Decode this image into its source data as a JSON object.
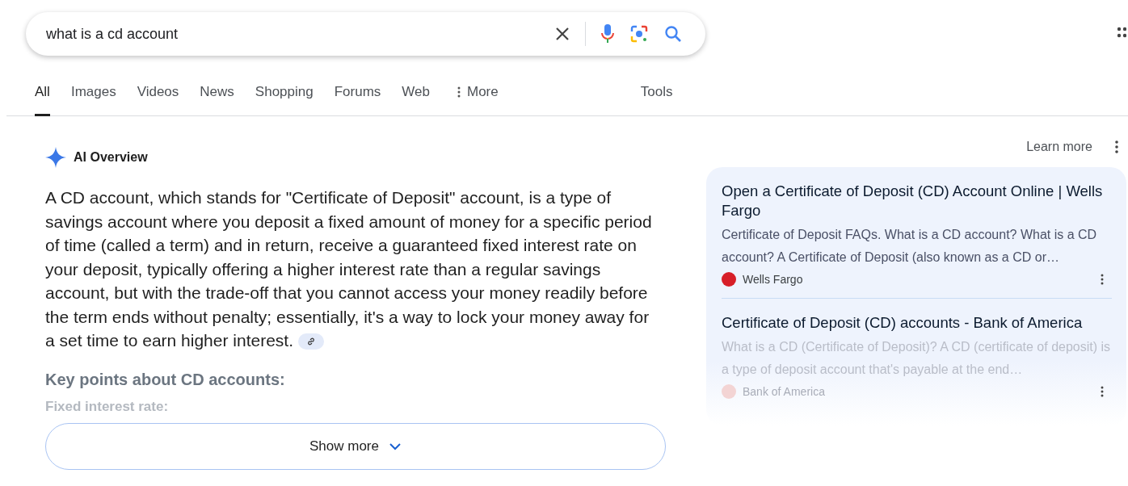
{
  "search": {
    "value": "what is a cd account"
  },
  "tabs": [
    {
      "label": "All",
      "selected": true
    },
    {
      "label": "Images",
      "selected": false
    },
    {
      "label": "Videos",
      "selected": false
    },
    {
      "label": "News",
      "selected": false
    },
    {
      "label": "Shopping",
      "selected": false
    },
    {
      "label": "Forums",
      "selected": false
    },
    {
      "label": "Web",
      "selected": false
    }
  ],
  "more_label": "More",
  "tools_label": "Tools",
  "ai_overview": {
    "title": "AI Overview",
    "learn_more": "Learn more",
    "paragraph": "A CD account, which stands for \"Certificate of Deposit\" account, is a type of savings account where you deposit a fixed amount of money for a specific period of time (called a term) and in return, receive a guaranteed fixed interest rate on your deposit, typically offering a higher interest rate than a regular savings account, but with the trade-off that you cannot access your money readily before the term ends without penalty; essentially, it's a way to lock your money away for a set time to earn higher interest.",
    "key_points_heading": "Key points about CD accounts:",
    "faded_point": "Fixed interest rate:",
    "show_more": "Show more"
  },
  "sources": [
    {
      "title": "Open a Certificate of Deposit (CD) Account Online | Wells Fargo",
      "snippet": "Certificate of Deposit FAQs. What is a CD account? What is a CD account? A Certificate of Deposit (also known as a CD or…",
      "site": "Wells Fargo",
      "faded": false
    },
    {
      "title": "Certificate of Deposit (CD) accounts - Bank of America",
      "snippet": "What is a CD (Certificate of Deposit)? A CD (certificate of deposit) is a type of deposit account that's payable at the end…",
      "site": "Bank of America",
      "faded": true
    }
  ]
}
